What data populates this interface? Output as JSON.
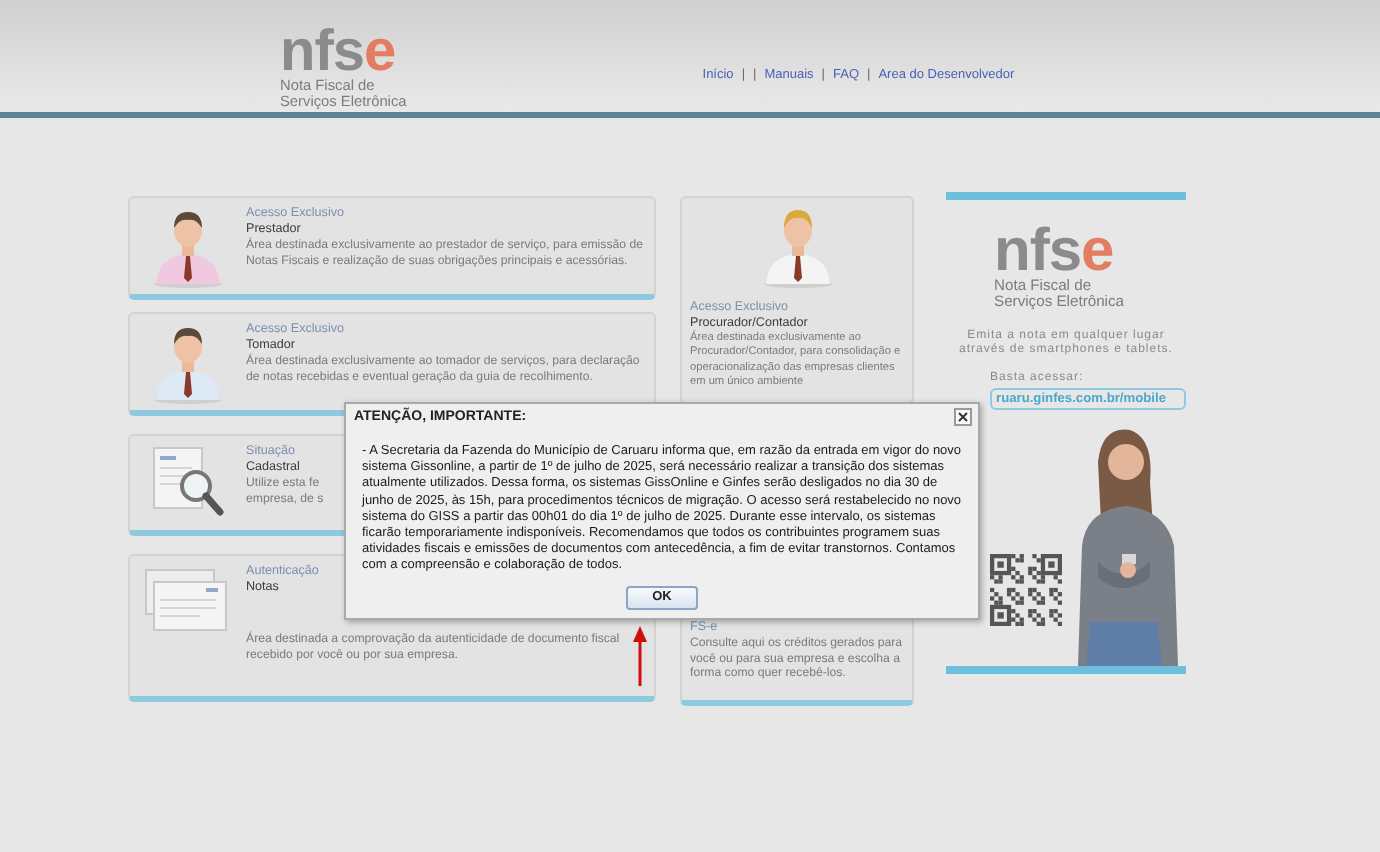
{
  "header": {
    "logo": {
      "word": "nfs",
      "accent": "e",
      "tagline": [
        "Nota Fiscal de",
        "Serviços Eletrônica"
      ]
    },
    "nav": [
      {
        "kind": "link",
        "label": "Início"
      },
      {
        "kind": "separator",
        "label": "|"
      },
      {
        "kind": "separator",
        "label": "|"
      },
      {
        "kind": "link",
        "label": "Manuais"
      },
      {
        "kind": "separator",
        "label": "|"
      },
      {
        "kind": "link",
        "label": "FAQ"
      },
      {
        "kind": "separator",
        "label": "|"
      },
      {
        "kind": "link",
        "label": "Area do Desenvolvedor"
      }
    ]
  },
  "cards": [
    {
      "kind": "person",
      "label": "Acesso Exclusivo",
      "title": "Prestador",
      "text": "Área destinada exclusivamente ao prestador de serviço, para emissão de Notas Fiscais e realização de suas obrigações principais e acessórias.",
      "color": "#f0c8e0"
    },
    {
      "kind": "person",
      "label": "Acesso Exclusivo",
      "title": "Tomador",
      "text": "Área destinada exclusivamente ao tomador de serviços, para declaração de notas recebidas e eventual geração da guia de recolhimento.",
      "color": "#dde9f5"
    },
    {
      "kind": "search",
      "label": "Situação",
      "title": "Cadastral",
      "lines": [
        "Utilize esta fe",
        "empresa, de s"
      ]
    },
    {
      "kind": "documents",
      "label": "Autenticação",
      "title": "Notas",
      "text": "Área destinada a comprovação da autenticidade de documento fiscal recebido por você ou por sua empresa."
    }
  ],
  "middle": {
    "top": {
      "label": "Acesso Exclusivo",
      "title": "Procurador/Contador",
      "text": "Área destinada exclusivamente ao Procurador/Contador, para consolidação e operacionalização das empresas clientes em um único ambiente"
    },
    "bottom": {
      "title": "FS-e",
      "text": "Consulte aqui os créditos gerados para você ou para sua empresa e escolha a forma como quer recebê-los."
    }
  },
  "promo": {
    "logo": {
      "word": "nfs",
      "accent": "e",
      "tagline": [
        "Nota Fiscal de",
        "Serviços Eletrônica"
      ]
    },
    "text": "Emita a nota em qualquer lugar através de smartphones e tablets.",
    "hint": "Basta acessar:",
    "url": "ruaru.ginfes.com.br/mobile"
  },
  "dialog": {
    "title": "ATENÇÃO, IMPORTANTE:",
    "message": "- A Secretaria da Fazenda do Município de Caruaru informa que, em razão da entrada em vigor do novo sistema Gissonline, a partir de 1º de julho de 2025, será necessário realizar a transição dos sistemas atualmente utilizados. Dessa forma, os sistemas GissOnline e Ginfes serão desligados no dia 30 de junho de 2025, às 15h, para procedimentos técnicos de migração. O acesso será restabelecido no novo sistema do GISS a partir das 00h01 do dia 1º de julho de 2025. Durante esse intervalo, os sistemas ficarão temporariamente indisponíveis. Recomendamos que todos os contribuintes programem suas atividades fiscais e emissões de documentos com antecedência, a fim de evitar transtornos. Contamos com a compreensão e colaboração de todos.",
    "button": "OK"
  }
}
